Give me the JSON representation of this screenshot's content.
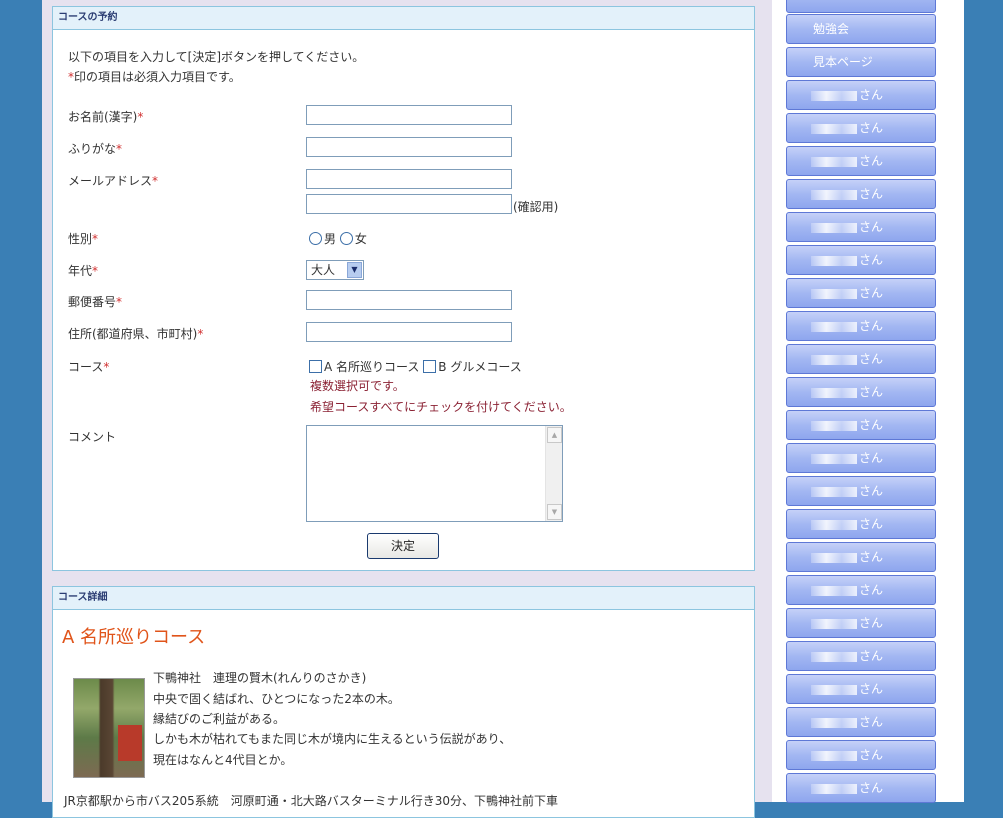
{
  "reservation": {
    "header": "コースの予約",
    "intro_line1": "以下の項目を入力して[決定]ボタンを押してください。",
    "intro_line2_mark": "*",
    "intro_line2_rest": "印の項目は必須入力項目です。",
    "required_mark": "*",
    "name_label": "お名前(漢字)",
    "furigana_label": "ふりがな",
    "email_label": "メールアドレス",
    "confirm_note": "(確認用)",
    "gender_label": "性別",
    "gender_male": "男",
    "gender_female": "女",
    "age_label": "年代",
    "age_value": "大人",
    "postal_label": "郵便番号",
    "address_label": "住所(都道府県、市町村)",
    "course_label": "コース",
    "course_a": "A 名所巡りコース",
    "course_b": "B グルメコース",
    "course_note1": "複数選択可です。",
    "course_note2": "希望コースすべてにチェックを付けてください。",
    "comment_label": "コメント",
    "submit_label": "決定"
  },
  "details": {
    "header": "コース詳細",
    "course_title": "A 名所巡りコース",
    "lines": [
      "下鴨神社　連理の賢木(れんりのさかき)",
      "中央で固く結ばれ、ひとつになった2本の木。",
      "縁結びのご利益がある。",
      "しかも木が枯れてもまた同じ木が境内に生えるという伝説があり、",
      "現在はなんと4代目とか。"
    ],
    "access": "JR京都駅から市バス205系統　河原町通・北大路バスターミナル行き30分、下鴨神社前下車"
  },
  "sidebar": {
    "study": "勉強会",
    "sample": "見本ページ",
    "san": "さん",
    "person_count": 22
  },
  "colors": {
    "background": "#3a7fb5",
    "panel_header": "#e3f1fa",
    "required": "#d13030",
    "course_title": "#e0541a",
    "nav_button": "#a3b7f2"
  }
}
